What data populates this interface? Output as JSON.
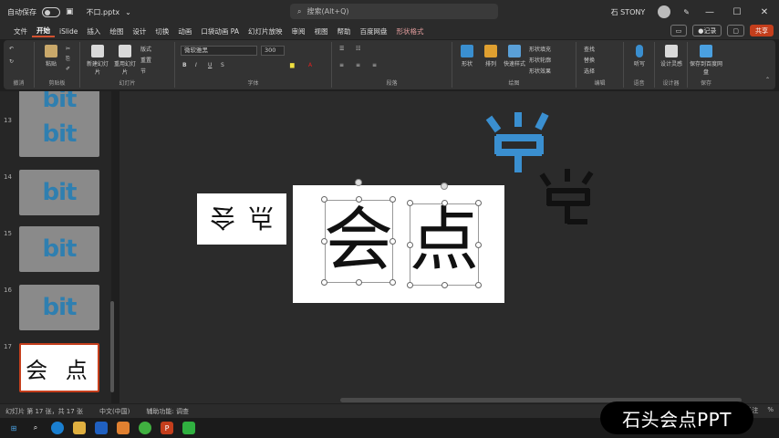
{
  "titlebar": {
    "autosave_label": "自动保存",
    "autosave_state": "关",
    "file_name": "不口.pptx",
    "search_placeholder": "搜索(Alt+Q)",
    "user_name": "石 STONY",
    "minimize": "—",
    "maximize": "☐",
    "close": "✕"
  },
  "menu": {
    "tabs": [
      "文件",
      "开始",
      "iSlide",
      "插入",
      "绘图",
      "设计",
      "切换",
      "动画",
      "口袋动画 PA",
      "幻灯片放映",
      "审阅",
      "视图",
      "帮助",
      "百度网盘",
      "形状格式"
    ],
    "active_index": 1,
    "contextual_index": 14,
    "record_label": "记录",
    "share_label": "共享"
  },
  "ribbon": {
    "groups": [
      "撤消",
      "剪贴板",
      "幻灯片",
      "字体",
      "段落",
      "绘图",
      "编辑",
      "语音",
      "设计器",
      "保存"
    ],
    "paste_label": "粘贴",
    "new_slide_label": "新建幻灯片",
    "reuse_slide_label": "重用幻灯片",
    "layout_label": "版式",
    "reset_label": "重置",
    "section_label": "节",
    "font_name": "微软雅黑",
    "font_size": "300",
    "shape_label": "形状",
    "arrange_label": "排列",
    "quick_styles_label": "快速样式",
    "shape_fill_label": "形状填充",
    "shape_outline_label": "形状轮廓",
    "shape_effects_label": "形状效果",
    "find_label": "查找",
    "replace_label": "替换",
    "select_label": "选择",
    "dictate_label": "听写",
    "designer_label": "设计灵感",
    "save_baidu_label": "保存到百度网盘"
  },
  "thumbnails": [
    {
      "number": "13",
      "text": "bit"
    },
    {
      "number": "14",
      "text": "bit"
    },
    {
      "number": "15",
      "text": "bit"
    },
    {
      "number": "16",
      "text": "bit"
    },
    {
      "number": "17",
      "text": "会 点",
      "active": true
    }
  ],
  "canvas": {
    "small_slide_text_left": "会",
    "small_slide_text_right": "点",
    "char_left": "会",
    "char_right": "点",
    "floating_char": "点"
  },
  "status": {
    "slide_info": "幻灯片 第 17 张，共 17 张",
    "language": "中文(中国)",
    "accessibility": "辅助功能: 调查",
    "notes": "备注",
    "zoom": "%"
  },
  "watermark": "石头会点PPT",
  "colors": {
    "accent": "#c43e1c",
    "logo_blue": "#2f7fb0",
    "float_blue": "#3a8fd0"
  }
}
